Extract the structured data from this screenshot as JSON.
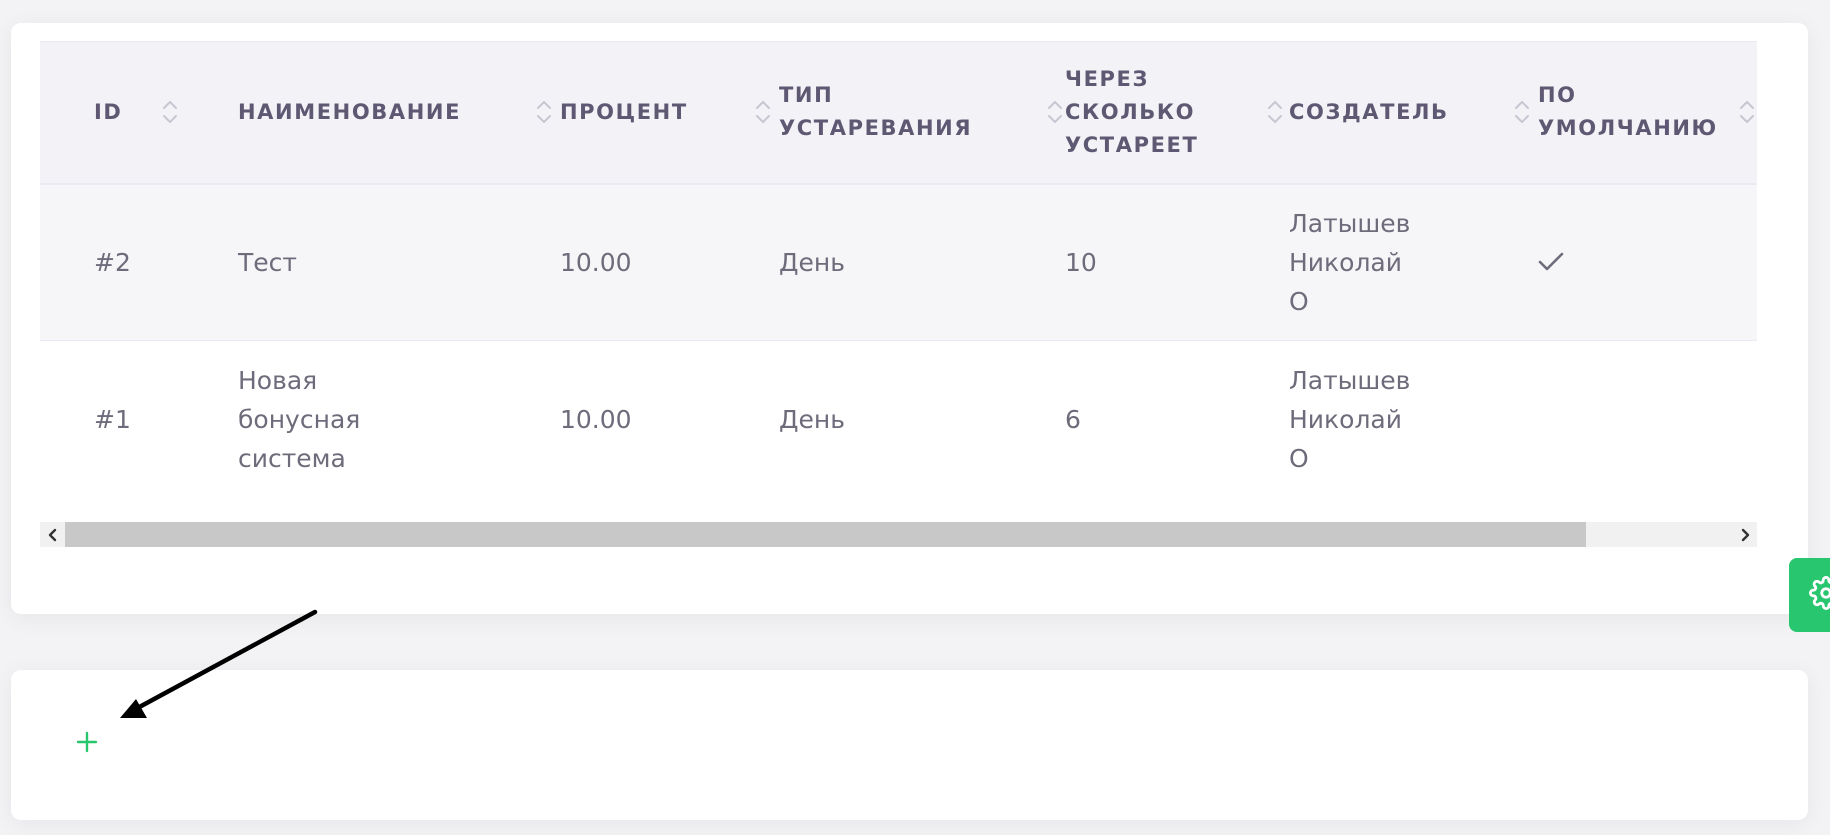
{
  "table": {
    "columns": [
      {
        "label": "ID"
      },
      {
        "label": "НАИМЕНОВАНИЕ"
      },
      {
        "label": "ПРОЦЕНТ"
      },
      {
        "label": "ТИП\nУСТАРЕВАНИЯ"
      },
      {
        "label": "ЧЕРЕЗ\nСКОЛЬКО\nУСТАРЕЕТ"
      },
      {
        "label": "СОЗДАТЕЛЬ"
      },
      {
        "label": "ПО\nУМОЛЧАНИЮ"
      }
    ],
    "rows": [
      {
        "id": "#2",
        "name": "Тест",
        "percent": "10.00",
        "expiry_type": "День",
        "expires_in": "10",
        "creator": "Латышев\nНиколай\nО",
        "is_default": true
      },
      {
        "id": "#1",
        "name": "Новая\nбонусная\nсистема",
        "percent": "10.00",
        "expiry_type": "День",
        "expires_in": "6",
        "creator": "Латышев\nНиколай\nО",
        "is_default": false
      }
    ]
  },
  "icons": {
    "sort": "sort-updown-icon",
    "check": "check-icon",
    "settings": "gear-icon",
    "add": "plus-icon",
    "scroll_left": "chevron-left-icon",
    "scroll_right": "chevron-right-icon",
    "annotation": "annotation-arrow"
  },
  "colors": {
    "accent": "#28c76f",
    "header_bg": "#f3f2f7",
    "row_alt_bg": "#f6f6f9",
    "text": "#6e6b7b",
    "header_text": "#5e5873"
  },
  "scroll": {
    "visible_fraction": 0.9
  }
}
